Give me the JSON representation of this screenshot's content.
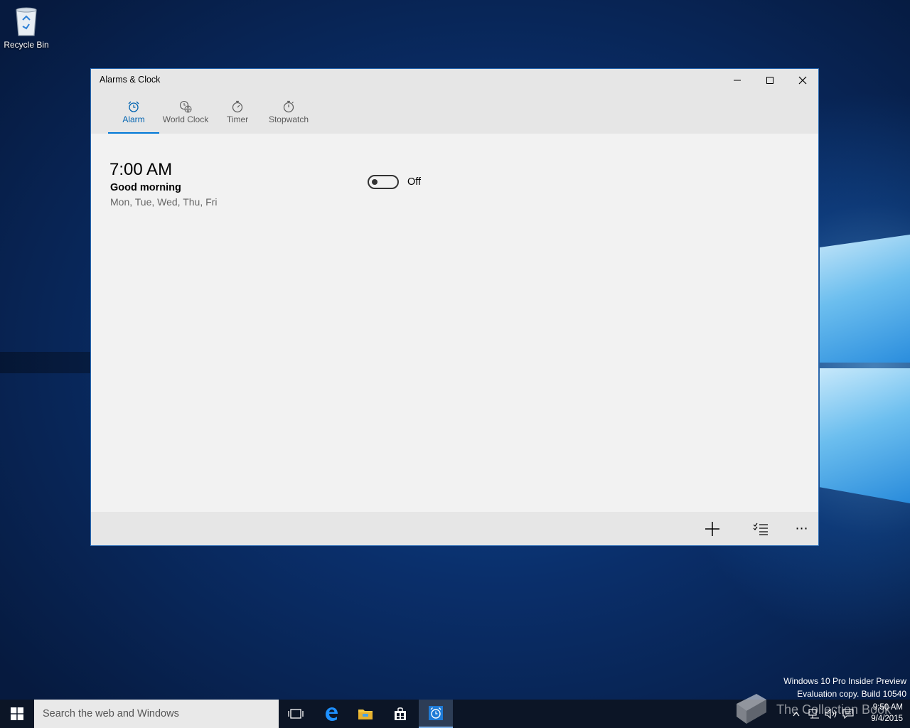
{
  "desktop": {
    "recycle_bin_label": "Recycle Bin",
    "watermark_line1": "Windows 10 Pro Insider Preview",
    "watermark_line2": "Evaluation copy. Build 10540",
    "book_watermark": "The Collection Book"
  },
  "window": {
    "title": "Alarms & Clock",
    "controls": [
      "minimize-icon",
      "maximize-icon",
      "close-icon"
    ],
    "accent_color": "#0078d7"
  },
  "tabs": [
    {
      "label": "Alarm",
      "icon": "alarm-clock-icon",
      "active": true
    },
    {
      "label": "World Clock",
      "icon": "globe-clock-icon",
      "active": false
    },
    {
      "label": "Timer",
      "icon": "timer-icon",
      "active": false
    },
    {
      "label": "Stopwatch",
      "icon": "stopwatch-icon",
      "active": false
    }
  ],
  "alarm": {
    "time": "7:00 AM",
    "name": "Good morning",
    "days": "Mon, Tue, Wed, Thu, Fri",
    "toggle_state": "Off"
  },
  "commandbar": {
    "add": "plus-icon",
    "select": "select-list-icon",
    "more": "⋯"
  },
  "taskbar": {
    "search_placeholder": "Search the web and Windows",
    "time": "9:50 AM",
    "date": "9/4/2015"
  }
}
